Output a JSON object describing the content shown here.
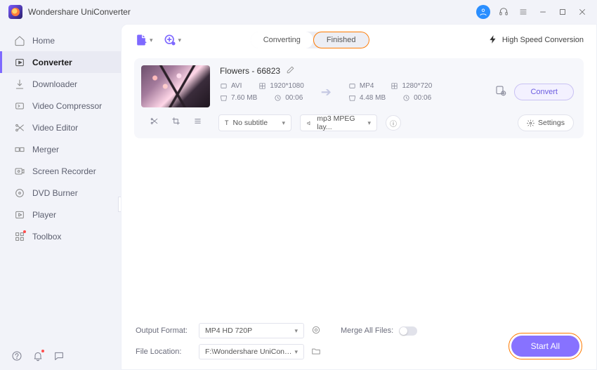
{
  "app": {
    "title": "Wondershare UniConverter"
  },
  "window": {
    "user_initial": ""
  },
  "sidebar": {
    "items": [
      {
        "label": "Home"
      },
      {
        "label": "Converter"
      },
      {
        "label": "Downloader"
      },
      {
        "label": "Video Compressor"
      },
      {
        "label": "Video Editor"
      },
      {
        "label": "Merger"
      },
      {
        "label": "Screen Recorder"
      },
      {
        "label": "DVD Burner"
      },
      {
        "label": "Player"
      },
      {
        "label": "Toolbox"
      }
    ]
  },
  "tabs": {
    "converting": "Converting",
    "finished": "Finished"
  },
  "toolbar": {
    "high_speed": "High Speed Conversion"
  },
  "file": {
    "title": "Flowers - 66823",
    "src": {
      "format": "AVI",
      "resolution": "1920*1080",
      "size": "7.60 MB",
      "duration": "00:06"
    },
    "dst": {
      "format": "MP4",
      "resolution": "1280*720",
      "size": "4.48 MB",
      "duration": "00:06"
    },
    "convert_label": "Convert",
    "subtitle": "No subtitle",
    "audio": "mp3 MPEG lay...",
    "settings_label": "Settings"
  },
  "footer": {
    "output_format_label": "Output Format:",
    "output_format_value": "MP4 HD 720P",
    "file_location_label": "File Location:",
    "file_location_value": "F:\\Wondershare UniConverter",
    "merge_label": "Merge All Files:",
    "start_label": "Start All"
  }
}
